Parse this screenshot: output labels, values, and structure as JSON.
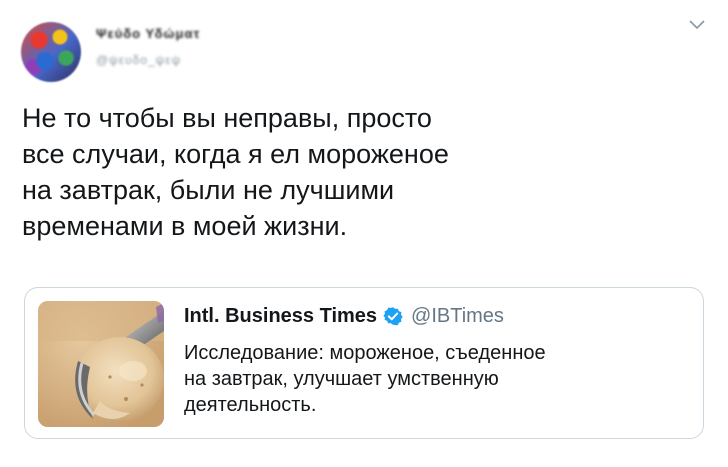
{
  "tweet": {
    "author": {
      "name": "Ψεύδο Υδώματ",
      "handle": "@ψευδο_ψεψ"
    },
    "text_lines": [
      "Не то чтобы вы неправы, просто",
      "все случаи, когда я ел мороженое",
      "на завтрак, были не лучшими",
      "временами в моей жизни."
    ]
  },
  "quoted_tweet": {
    "name": "Intl. Business Times",
    "handle": "@IBTimes",
    "text_lines": [
      "Исследование: мороженое, съеденное",
      "на завтрак, улучшает умственную",
      "деятельность."
    ]
  },
  "icons": {
    "menu": "chevron-down-icon",
    "verified": "verified-badge-icon"
  },
  "colors": {
    "verified": "#1da1f2",
    "text": "#14171a",
    "secondary_text": "#657786",
    "border": "#ccd6dd"
  }
}
